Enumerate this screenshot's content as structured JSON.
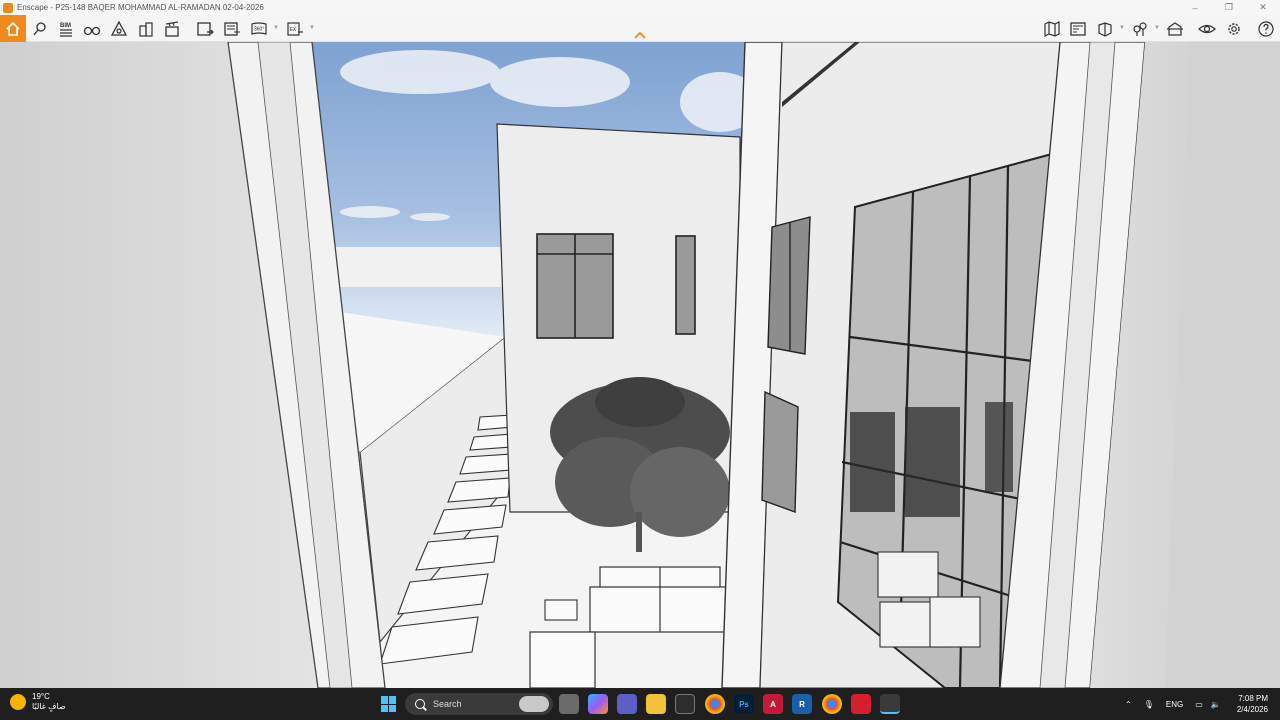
{
  "window": {
    "title": "Enscape - P25-148 BAQER MOHAMMAD AL-RAMADAN 02-04-2026",
    "controls": [
      "–",
      "❐",
      "✕"
    ]
  },
  "toolbar": {
    "left_icons": [
      "home-icon",
      "location-pin-icon",
      "bim-info-icon",
      "binoculars-icon",
      "navigation-icon",
      "buildings-icon",
      "video-editor-icon",
      "render-image-icon",
      "batch-render-icon",
      "panorama-360-icon",
      "export-icon"
    ],
    "bim_label": "BIM",
    "pano_label": "360°",
    "export_label": "EX",
    "right_icons": [
      "map-icon",
      "sketch-style-icon",
      "materials-icon",
      "asset-library-icon",
      "visual-settings-icon",
      "view-visibility-icon",
      "settings-gear-icon",
      "help-icon"
    ],
    "colors": {
      "accent": "#f08a1c",
      "toolbar_bg": "#f5f5f5"
    }
  },
  "scene": {
    "description_icons": [
      "sky",
      "courtyard",
      "tree",
      "sofa",
      "armchair",
      "staircase"
    ]
  },
  "taskbar": {
    "weather": {
      "temp": "19°C",
      "condition": "صافٍ غالبًا"
    },
    "search_placeholder": "Search",
    "apps": [
      "file-explorer-icon",
      "copilot-icon",
      "teams-icon",
      "folder-icon",
      "app-dark-icon",
      "chrome-icon",
      "photoshop-icon",
      "autocad-icon",
      "revit-icon",
      "chrome-profile-icon",
      "acrobat-icon",
      "enscape-icon"
    ],
    "photoshop_label": "Ps",
    "autocad_label": "A",
    "revit_label": "R",
    "language": "ENG",
    "time": "7:08 PM",
    "date": "2/4/2026",
    "colors": {
      "taskbar_bg": "#1f1f1f",
      "start_blue": "#4cc2ff"
    }
  }
}
